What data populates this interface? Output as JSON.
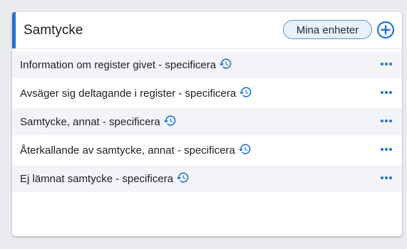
{
  "panel": {
    "title": "Samtycke",
    "units_button_label": "Mina enheter",
    "add_icon": "plus-circle-icon",
    "accent_color": "#1f73d6"
  },
  "items": [
    {
      "label": "Information om register givet - specificera",
      "icon": "history-icon"
    },
    {
      "label": "Avsäger sig deltagande i register - specificera",
      "icon": "history-icon"
    },
    {
      "label": "Samtycke, annat - specificera",
      "icon": "history-icon"
    },
    {
      "label": "Återkallande av samtycke, annat - specificera",
      "icon": "history-icon"
    },
    {
      "label": "Ej lämnat samtycke - specificera",
      "icon": "history-icon"
    }
  ]
}
